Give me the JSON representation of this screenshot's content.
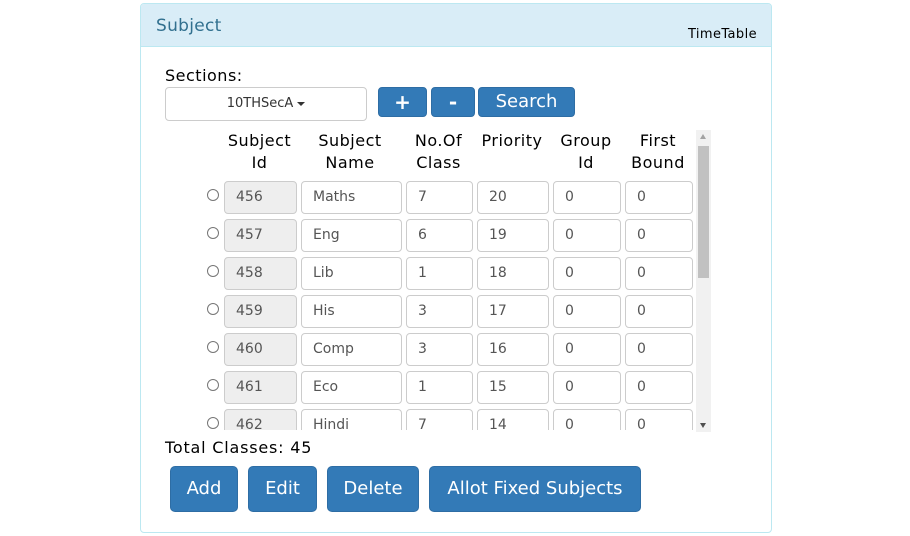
{
  "panel": {
    "title": "Subject",
    "link": "TimeTable"
  },
  "sections": {
    "label": "Sections:",
    "selected": "10THSecA",
    "add_label": "+",
    "remove_label": "-",
    "search_label": "Search"
  },
  "table": {
    "headers": {
      "subject_id": [
        "Subject",
        "Id"
      ],
      "subject_name": [
        "Subject",
        "Name"
      ],
      "no_of_class": [
        "No.Of",
        "Class"
      ],
      "priority": [
        "Priority",
        ""
      ],
      "group_id": [
        "Group",
        "Id"
      ],
      "first_bound": [
        "First",
        "Bound"
      ]
    },
    "rows": [
      {
        "id": "456",
        "name": "Maths",
        "classes": "7",
        "priority": "20",
        "group": "0",
        "first": "0"
      },
      {
        "id": "457",
        "name": "Eng",
        "classes": "6",
        "priority": "19",
        "group": "0",
        "first": "0"
      },
      {
        "id": "458",
        "name": "Lib",
        "classes": "1",
        "priority": "18",
        "group": "0",
        "first": "0"
      },
      {
        "id": "459",
        "name": "His",
        "classes": "3",
        "priority": "17",
        "group": "0",
        "first": "0"
      },
      {
        "id": "460",
        "name": "Comp",
        "classes": "3",
        "priority": "16",
        "group": "0",
        "first": "0"
      },
      {
        "id": "461",
        "name": "Eco",
        "classes": "1",
        "priority": "15",
        "group": "0",
        "first": "0"
      },
      {
        "id": "462",
        "name": "Hindi",
        "classes": "7",
        "priority": "14",
        "group": "0",
        "first": "0"
      }
    ]
  },
  "total": {
    "label": "Total Classes:",
    "value": "45"
  },
  "actions": {
    "add": "Add",
    "edit": "Edit",
    "delete": "Delete",
    "allot": "Allot Fixed Subjects"
  },
  "colors": {
    "primary": "#337ab7",
    "heading_bg": "#d9edf7",
    "heading_text": "#31708f"
  }
}
